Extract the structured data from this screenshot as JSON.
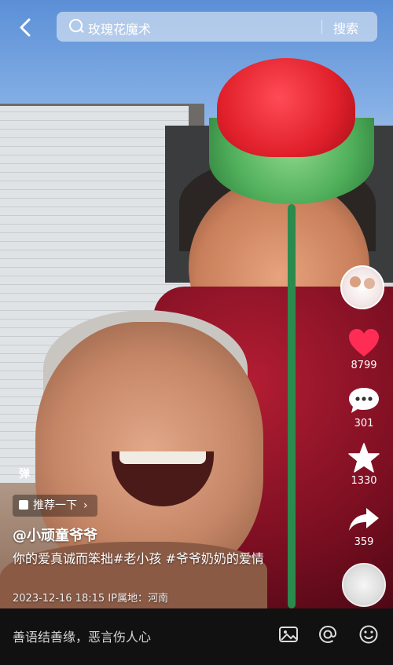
{
  "search": {
    "query": "玫瑰花魔术",
    "button": "搜索"
  },
  "actions": {
    "likes": "8799",
    "comments": "301",
    "favorites": "1330",
    "shares": "359"
  },
  "overlay": {
    "danmu": "弹",
    "recommend": "推荐一下",
    "recommend_arrow": "›"
  },
  "post": {
    "author": "@小顽童爷爷",
    "description": "你的爱真诚而笨拙#老小孩 #爷爷奶奶的爱情",
    "meta": "2023-12-16 18:15  IP属地：河南"
  },
  "bottom_bar": {
    "comment_placeholder": "善语结善缘，恶言伤人心"
  },
  "icons": [
    "back-icon",
    "search-icon",
    "heart-icon",
    "comment-icon",
    "star-icon",
    "share-icon",
    "image-icon",
    "at-icon",
    "emoji-icon"
  ],
  "colors": {
    "like": "#ff2c55",
    "bottom_bar": "#111111"
  }
}
